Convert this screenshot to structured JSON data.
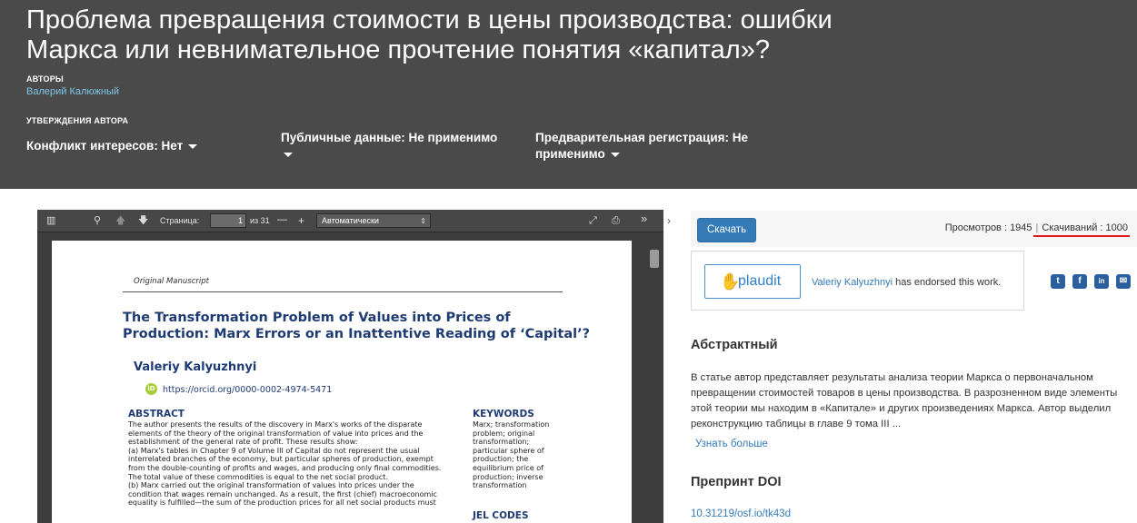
{
  "header": {
    "title": "Проблема превращения стоимости в цены производства: ошибки Маркса или невнимательное прочтение понятия «капитал»?",
    "authors_label": "АВТОРЫ",
    "author_name": "Валерий Калюжный",
    "statements_label": "УТВЕРЖДЕНИЯ АВТОРА",
    "conflict": "Конфликт интересов:  Нет",
    "public_data": "Публичные данные:  Не применимо",
    "prereg": "Предварительная регистрация:  Не применимо"
  },
  "viewer": {
    "page_label": "Страница:",
    "page_value": "1",
    "page_total": "из 31",
    "zoom_value": "Автоматически",
    "minus": "—",
    "plus": "+"
  },
  "pdf": {
    "manuscript_label": "Original Manuscript",
    "title": "The Transformation Problem of Values into Prices of Production: Marx Errors or an Inattentive Reading of ‘Capital’?",
    "author": "Valeriy Kalyuzhnyi",
    "orcid_badge": "iD",
    "orcid": "https://orcid.org/0000-0002-4974-5471",
    "abstract_head": "ABSTRACT",
    "abstract_text": "The author presents the results of the discovery in Marx's works of the disparate\nelements of the theory of the original transformation of value into prices and the\nestablishment of the general rate of profit. These results show:\n(a) Marx's tables in Chapter 9 of Volume III of Capital do not represent the usual\ninterrelated branches of the economy, but particular spheres of production, exempt\nfrom the double-counting of profits and wages, and producing only final commodities.\nThe total value of these commodities is equal to the net social product.\n(b) Marx carried out the original transformation of values into prices under the\ncondition that wages remain unchanged. As a result, the first (chief) macroeconomic\nequality is fulfilled—the sum of the production prices for all net social products must",
    "keywords_head": "KEYWORDS",
    "keywords_text": "Marx; transformation\nproblem; original\ntransformation;\nparticular sphere of\nproduction; the\nequilibrium price of\nproduction; inverse\ntransformation",
    "jel_head": "JEL CODES"
  },
  "sidebar": {
    "download_label": "Скачать",
    "views": "Просмотров : 1945",
    "separator": "|",
    "downloads": "Скачиваний : 1000",
    "plaudit_word": "plaudit",
    "endorser": "Valeriy Kalyuzhnyi",
    "endorse_text": " has endorsed this work.",
    "abstract_title": "Абстрактный",
    "abstract_text": "В статье автор представляет результаты анализа теории Маркса о первоначальном превращении стоимостей товаров в цены производства. В разрозненном виде элементы этой теории мы находим в «Капитале» и других произведениях Маркса. Автор выделил реконструкцию таблицы в главе 9 тома III ...",
    "learn_more": "Узнать больше",
    "doi_title": "Препринт DOI",
    "doi": "10.31219/osf.io/tk43d",
    "social": [
      "t",
      "f",
      "in",
      "✉"
    ]
  },
  "colors": {
    "header_bg": "#4a4a4b",
    "accent": "#337ab7",
    "author_link": "#7fc6e6",
    "underline": "#e01b1b",
    "paper_blue": "#1f3b73"
  }
}
